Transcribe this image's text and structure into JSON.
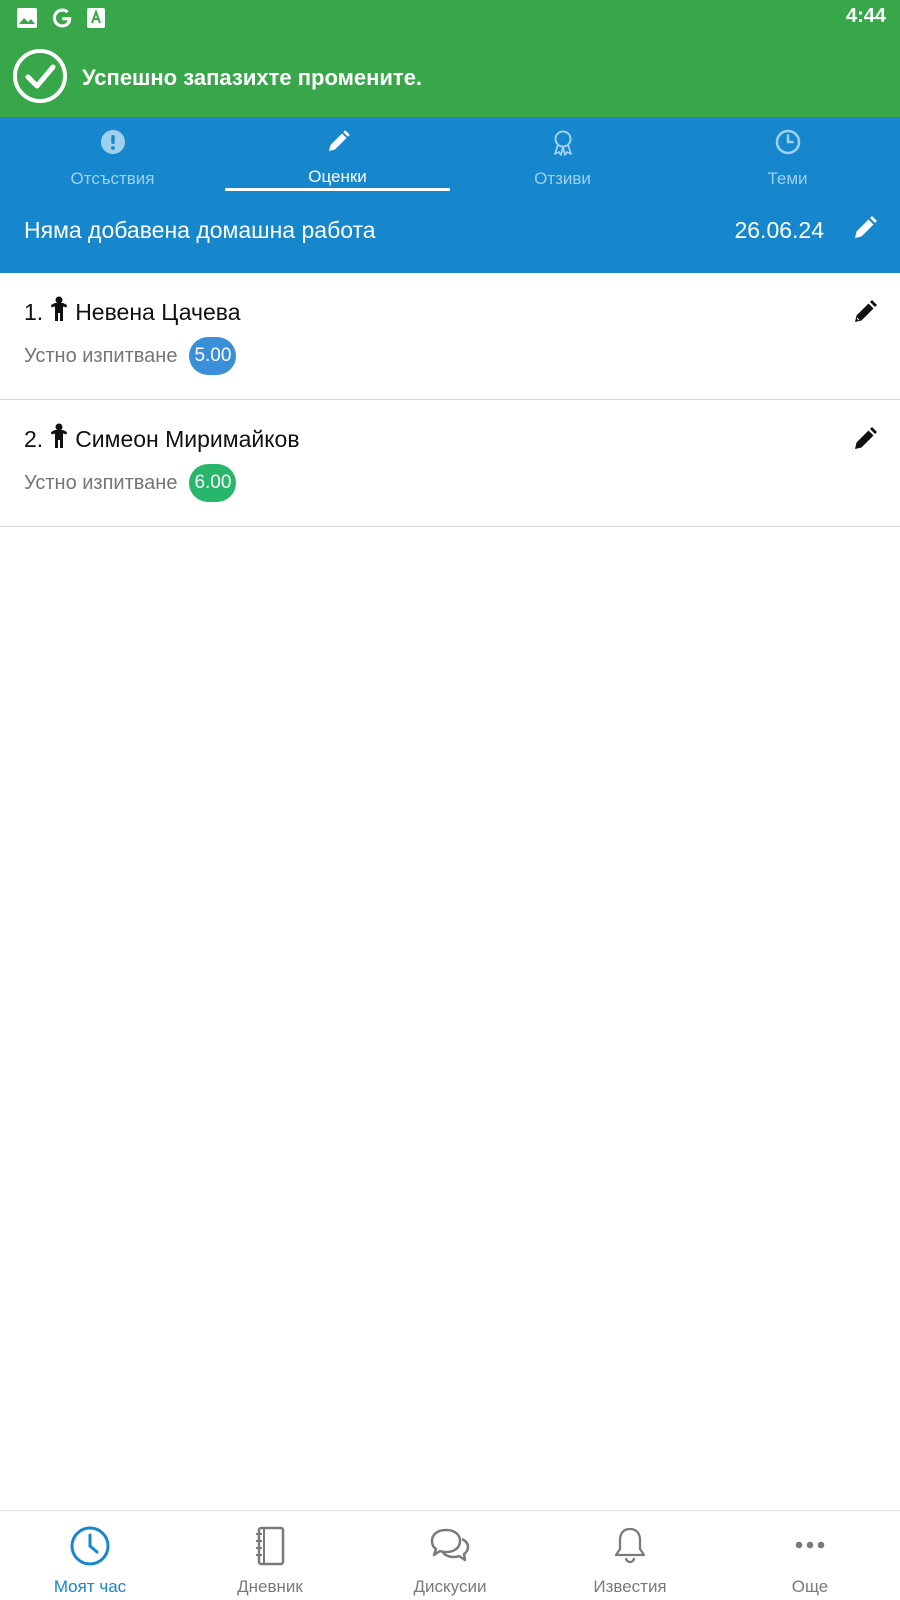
{
  "status_bar": {
    "time": "4:44",
    "icons": [
      "image-icon",
      "google-icon",
      "font-a-icon"
    ]
  },
  "toast": {
    "message": "Успешно запазихте промените.",
    "icon": "check-circle-icon"
  },
  "tabs": [
    {
      "label": "Отсъствия",
      "icon": "exclamation-circle-icon",
      "active": false
    },
    {
      "label": "Оценки",
      "icon": "pencil-icon",
      "active": true
    },
    {
      "label": "Отзиви",
      "icon": "ribbon-award-icon",
      "active": false
    },
    {
      "label": "Теми",
      "icon": "clock-icon",
      "active": false
    }
  ],
  "homework": {
    "text": "Няма добавена домашна работа",
    "date": "26.06.24"
  },
  "students": [
    {
      "number": "1.",
      "name": "Невена Цачева",
      "grade_type": "Устно изпитване",
      "grade": "5.00",
      "grade_color": "#3a8fd8"
    },
    {
      "number": "2.",
      "name": "Симеон Миримайков",
      "grade_type": "Устно изпитване",
      "grade": "6.00",
      "grade_color": "#27b66a"
    }
  ],
  "bottom_nav": [
    {
      "label": "Моят час",
      "icon": "clock-icon",
      "active": true
    },
    {
      "label": "Дневник",
      "icon": "notebook-icon",
      "active": false
    },
    {
      "label": "Дискусии",
      "icon": "chat-bubbles-icon",
      "active": false
    },
    {
      "label": "Известия",
      "icon": "bell-icon",
      "active": false
    },
    {
      "label": "Още",
      "icon": "more-dots-icon",
      "active": false
    }
  ],
  "colors": {
    "status_green": "#37a74a",
    "header_blue": "#1787cd",
    "nav_active": "#1787cd",
    "nav_inactive": "#7a7a7a"
  }
}
